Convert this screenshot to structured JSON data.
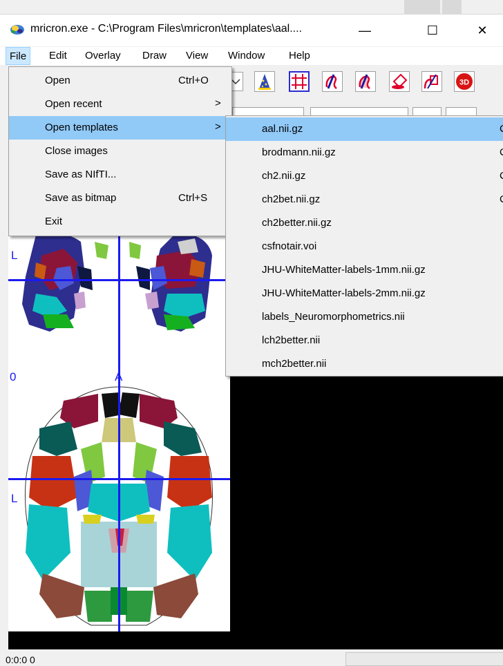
{
  "window": {
    "title": "mricron.exe - C:\\Program Files\\mricron\\templates\\aal....",
    "minimize_glyph": "—",
    "maximize_glyph": "☐",
    "close_glyph": "✕"
  },
  "menubar": {
    "items": [
      "File",
      "Edit",
      "Overlay",
      "Draw",
      "View",
      "Window",
      "Help"
    ]
  },
  "file_menu": {
    "items": [
      {
        "label": "Open",
        "shortcut": "Ctrl+O",
        "arrow": ""
      },
      {
        "label": "Open recent",
        "shortcut": "",
        "arrow": ">"
      },
      {
        "label": "Open templates",
        "shortcut": "",
        "arrow": ">"
      },
      {
        "label": "Close images",
        "shortcut": "",
        "arrow": ""
      },
      {
        "label": "Save as NIfTI...",
        "shortcut": "",
        "arrow": ""
      },
      {
        "label": "Save as bitmap",
        "shortcut": "Ctrl+S",
        "arrow": ""
      },
      {
        "label": "Exit",
        "shortcut": "",
        "arrow": ""
      }
    ],
    "highlighted": "Open templates"
  },
  "templates_menu": {
    "items": [
      "aal.nii.gz",
      "brodmann.nii.gz",
      "ch2.nii.gz",
      "ch2bet.nii.gz",
      "ch2better.nii.gz",
      "csfnotair.voi",
      "JHU-WhiteMatter-labels-1mm.nii.gz",
      "JHU-WhiteMatter-labels-2mm.nii.gz",
      "labels_Neuromorphometrics.nii",
      "lch2better.nii",
      "mch2better.nii"
    ],
    "highlighted": "aal.nii.gz",
    "clipped_glyph": "C"
  },
  "toolbar": {
    "icons": [
      "dropdown-icon",
      "wizard-hat-icon",
      "crosshair-icon",
      "pen-draw-icon",
      "pen-fill-icon",
      "eraser-icon",
      "fill-bucket-icon",
      "3d-render-icon"
    ],
    "render_3d_label": "3D"
  },
  "viewer": {
    "orientation_left": "L",
    "orientation_left_2": "L",
    "orientation_anterior": "A",
    "slice_label": "0",
    "crosshair_color": "#1a1af0"
  },
  "statusbar": {
    "text": "0:0:0 0"
  }
}
